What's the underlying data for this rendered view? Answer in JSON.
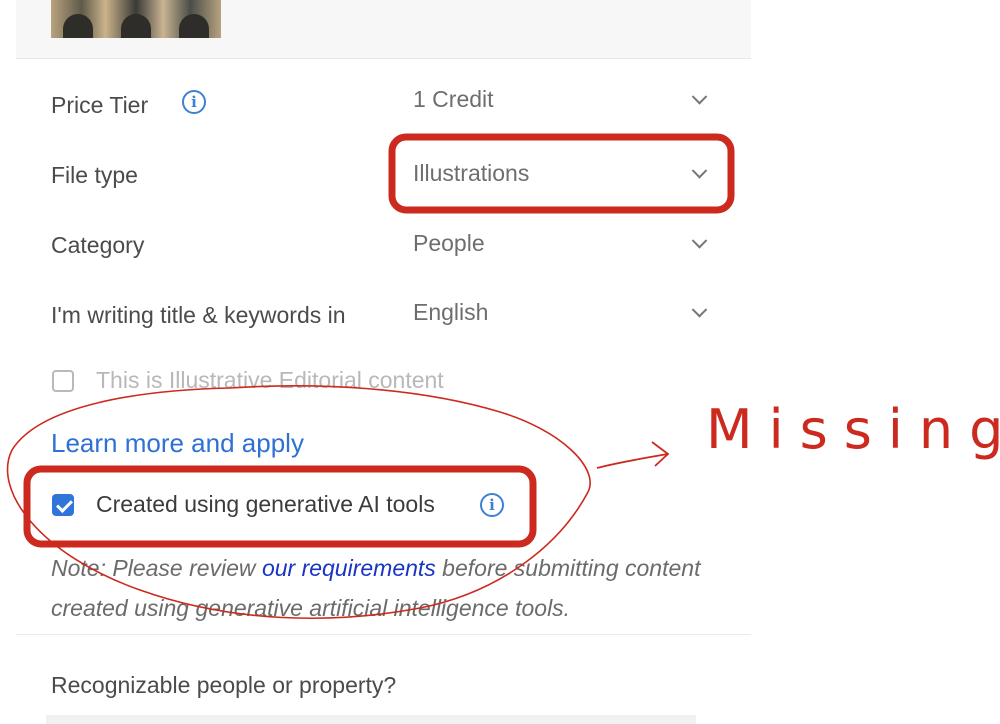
{
  "form": {
    "price_tier": {
      "label": "Price Tier",
      "value": "1 Credit"
    },
    "file_type": {
      "label": "File type",
      "value": "Illustrations"
    },
    "category": {
      "label": "Category",
      "value": "People"
    },
    "language": {
      "label": "I'm writing title & keywords in",
      "value": "English"
    },
    "editorial": {
      "label": "This is Illustrative Editorial content",
      "checked": false
    },
    "learn_more": "Learn more and apply",
    "generative_ai": {
      "label": "Created using generative AI tools",
      "checked": true
    },
    "note": {
      "prefix": "Note: Please review ",
      "link": "our requirements",
      "suffix": " before submitting content created using generative artificial intelligence tools."
    },
    "recognizable": "Recognizable people or property?"
  },
  "annotation": {
    "text": "Missing",
    "color": "#cc2a1e"
  },
  "colors": {
    "accent": "#2f76d8",
    "link": "#1a35c4",
    "annotation_red": "#cc2a1e"
  }
}
